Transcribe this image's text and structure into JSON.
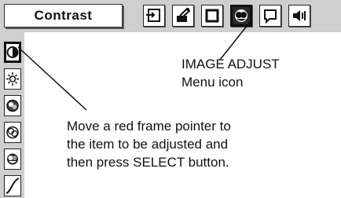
{
  "menu": {
    "title": "Contrast",
    "top_icons": [
      {
        "name": "input-icon",
        "selected": false
      },
      {
        "name": "setting-icon",
        "selected": false
      },
      {
        "name": "screen-icon",
        "selected": false
      },
      {
        "name": "image-adjust-icon",
        "selected": true
      },
      {
        "name": "guide-icon",
        "selected": false
      },
      {
        "name": "sound-icon",
        "selected": false
      }
    ]
  },
  "sidebar": {
    "items": [
      {
        "name": "contrast-icon",
        "selected": true
      },
      {
        "name": "brightness-icon",
        "selected": false
      },
      {
        "name": "color-icon",
        "selected": false
      },
      {
        "name": "tint-icon",
        "selected": false
      },
      {
        "name": "white-balance-icon",
        "selected": false
      },
      {
        "name": "gamma-icon",
        "selected": false
      }
    ]
  },
  "callouts": {
    "image_adjust": {
      "line1": "IMAGE  ADJUST",
      "line2": "Menu icon"
    },
    "pointer": {
      "line1": "Move a red frame pointer to",
      "line2": "the item to be adjusted and",
      "line3": "then press SELECT button."
    }
  }
}
